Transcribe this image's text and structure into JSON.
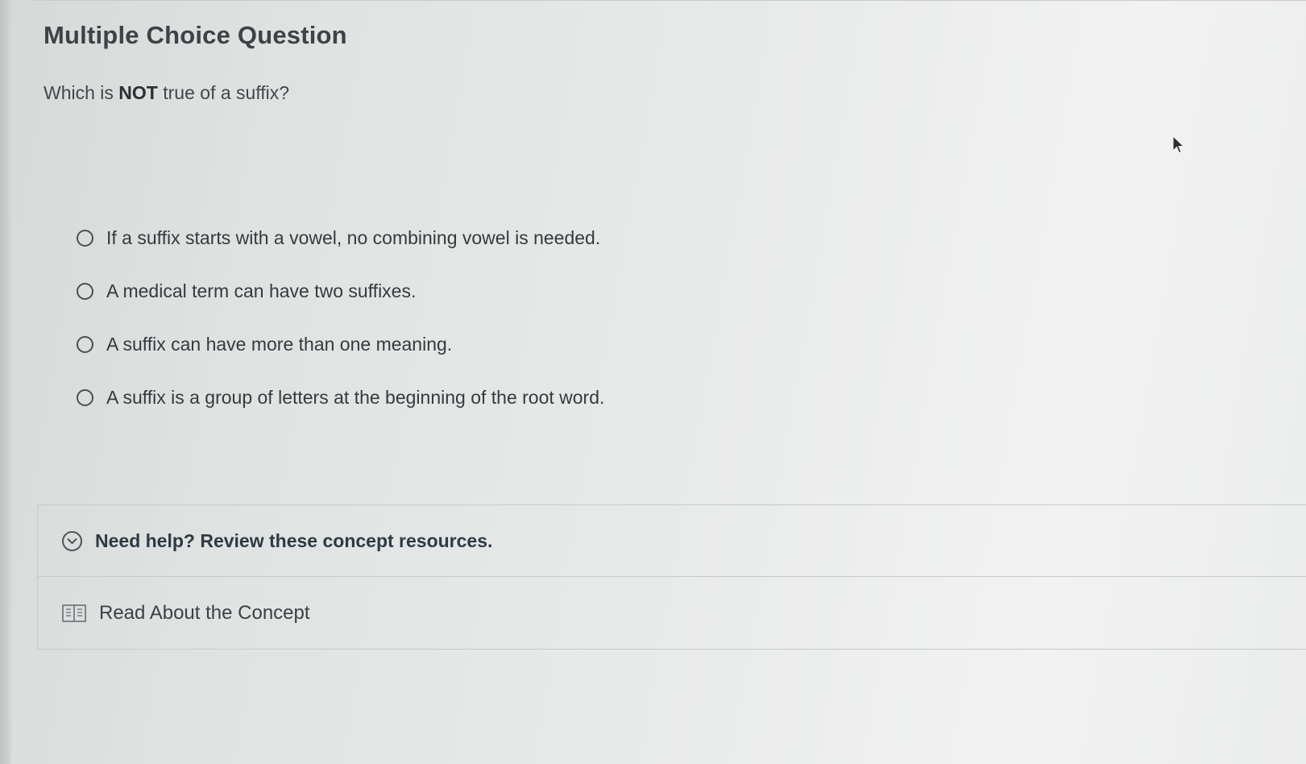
{
  "header": {
    "title": "Multiple Choice Question"
  },
  "question": {
    "prefix": "Which is ",
    "emphasis": "NOT",
    "suffix": " true of a suffix?"
  },
  "options": [
    {
      "label": "If a suffix starts with a vowel, no combining vowel is needed.",
      "selected": false
    },
    {
      "label": "A medical term can have two suffixes.",
      "selected": false
    },
    {
      "label": "A suffix can have more than one meaning.",
      "selected": false
    },
    {
      "label": "A suffix is a group of letters at the beginning of the root word.",
      "selected": false
    }
  ],
  "help": {
    "toggle_label": "Need help? Review these concept resources.",
    "toggle_icon": "chevron-down-circle-icon",
    "resource_label": "Read About the Concept",
    "resource_icon": "book-icon"
  },
  "colors": {
    "text": "#353a3f",
    "help_text": "#2e3a45",
    "border": "#c6cac9"
  }
}
